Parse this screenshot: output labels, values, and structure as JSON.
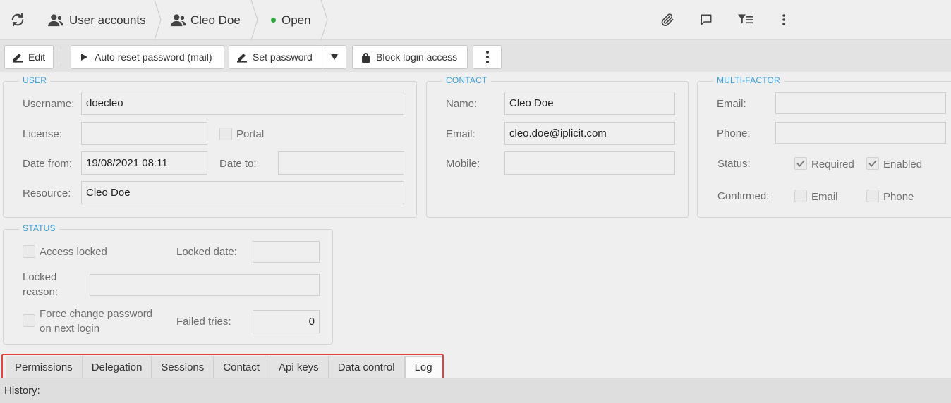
{
  "breadcrumb": {
    "refresh_icon": "refresh-icon",
    "items": [
      {
        "icon": "user-group-icon",
        "label": "User accounts"
      },
      {
        "icon": "user-icon",
        "label": "Cleo Doe"
      },
      {
        "icon": "status-dot",
        "label": "Open",
        "color": "#2aa83a"
      }
    ]
  },
  "top_actions": [
    "attachment-icon",
    "comment-icon",
    "filter-list-icon",
    "more-vertical-icon"
  ],
  "toolbar": {
    "edit_label": "Edit",
    "auto_reset_label": "Auto reset password (mail)",
    "set_password_label": "Set password",
    "block_login_label": "Block login access"
  },
  "user": {
    "title": "USER",
    "username_label": "Username:",
    "username_value": "doecleo",
    "license_label": "License:",
    "license_value": "",
    "portal_label": "Portal",
    "portal_checked": false,
    "date_from_label": "Date from:",
    "date_from_value": "19/08/2021 08:11",
    "date_to_label": "Date to:",
    "date_to_value": "",
    "resource_label": "Resource:",
    "resource_value": "Cleo Doe"
  },
  "contact": {
    "title": "CONTACT",
    "name_label": "Name:",
    "name_value": "Cleo Doe",
    "email_label": "Email:",
    "email_value": "cleo.doe@iplicit.com",
    "mobile_label": "Mobile:",
    "mobile_value": ""
  },
  "mfa": {
    "title": "MULTI-FACTOR",
    "email_label": "Email:",
    "email_value": "",
    "phone_label": "Phone:",
    "phone_value": "",
    "status_label": "Status:",
    "required_label": "Required",
    "required_checked": true,
    "enabled_label": "Enabled",
    "enabled_checked": true,
    "confirmed_label": "Confirmed:",
    "confirmed_email_label": "Email",
    "confirmed_email_checked": false,
    "confirmed_phone_label": "Phone",
    "confirmed_phone_checked": false
  },
  "status": {
    "title": "STATUS",
    "access_locked_label": "Access locked",
    "access_locked_checked": false,
    "locked_date_label": "Locked date:",
    "locked_date_value": "",
    "locked_reason_label_1": "Locked",
    "locked_reason_label_2": "reason:",
    "locked_reason_value": "",
    "force_change_label_1": "Force change password",
    "force_change_label_2": "on next login",
    "force_change_checked": false,
    "failed_tries_label": "Failed tries:",
    "failed_tries_value": "0"
  },
  "tabs": [
    {
      "label": "Permissions",
      "active": false
    },
    {
      "label": "Delegation",
      "active": false
    },
    {
      "label": "Sessions",
      "active": false
    },
    {
      "label": "Contact",
      "active": false
    },
    {
      "label": "Api keys",
      "active": false
    },
    {
      "label": "Data control",
      "active": false
    },
    {
      "label": "Log",
      "active": true
    }
  ],
  "history_label": "History:",
  "colors": {
    "accent": "#3aa0d8",
    "highlight": "#e04545",
    "status_open": "#2aa83a"
  }
}
